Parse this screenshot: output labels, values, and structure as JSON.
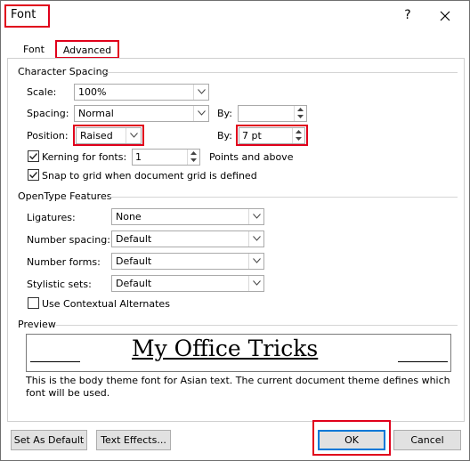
{
  "window": {
    "title": "Font",
    "help_label": "?",
    "close_label": "Close"
  },
  "tabs": [
    {
      "label": "Font",
      "mnemonic": "n",
      "active": false
    },
    {
      "label": "Advanced",
      "mnemonic": "v",
      "active": true
    }
  ],
  "character_spacing": {
    "header": "Character Spacing",
    "scale_label": "Scale:",
    "scale_value": "100%",
    "spacing_label": "Spacing:",
    "spacing_value": "Normal",
    "spacing_by_label": "By:",
    "spacing_by_value": "",
    "position_label": "Position:",
    "position_value": "Raised",
    "position_by_label": "By:",
    "position_by_value": "7 pt",
    "kerning_label": "Kerning for fonts:",
    "kerning_checked": true,
    "kerning_value": "1",
    "kerning_suffix": "Points and above",
    "snap_label": "Snap to grid when document grid is defined",
    "snap_checked": true
  },
  "opentype": {
    "header": "OpenType Features",
    "ligatures_label": "Ligatures:",
    "ligatures_value": "None",
    "number_spacing_label": "Number spacing:",
    "number_spacing_value": "Default",
    "number_forms_label": "Number forms:",
    "number_forms_value": "Default",
    "stylistic_sets_label": "Stylistic sets:",
    "stylistic_sets_value": "Default",
    "contextual_label": "Use Contextual Alternates",
    "contextual_checked": false
  },
  "preview": {
    "header": "Preview",
    "sample_text": "My Office Tricks",
    "description": "This is the body theme font for Asian text. The current document theme defines which font will be used."
  },
  "buttons": {
    "set_default": "Set As Default",
    "text_effects": "Text Effects...",
    "ok": "OK",
    "cancel": "Cancel"
  },
  "colors": {
    "highlight": "#e0001b",
    "ok_border": "#0078d7",
    "button_face": "#e1e1e1"
  }
}
